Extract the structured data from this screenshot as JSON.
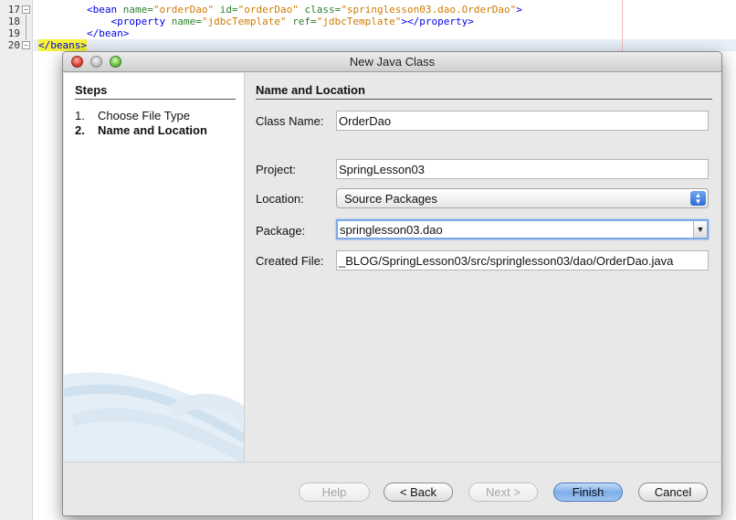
{
  "editor": {
    "line_numbers": [
      "17",
      "18",
      "19",
      "20"
    ],
    "lines": [
      [
        {
          "t": "        "
        },
        {
          "t": "<bean ",
          "c": "tag"
        },
        {
          "t": "name=",
          "c": "attr"
        },
        {
          "t": "\"orderDao\"",
          "c": "val"
        },
        {
          "t": " "
        },
        {
          "t": "id=",
          "c": "attr"
        },
        {
          "t": "\"orderDao\"",
          "c": "val"
        },
        {
          "t": " "
        },
        {
          "t": "class=",
          "c": "attr"
        },
        {
          "t": "\"springlesson03.dao.OrderDao\"",
          "c": "val"
        },
        {
          "t": ">",
          "c": "tag"
        }
      ],
      [
        {
          "t": "            "
        },
        {
          "t": "<property ",
          "c": "tag"
        },
        {
          "t": "name=",
          "c": "attr"
        },
        {
          "t": "\"jdbcTemplate\"",
          "c": "val"
        },
        {
          "t": " "
        },
        {
          "t": "ref=",
          "c": "attr"
        },
        {
          "t": "\"jdbcTemplate\"",
          "c": "val"
        },
        {
          "t": "></property>",
          "c": "tag"
        }
      ],
      [
        {
          "t": "        "
        },
        {
          "t": "</bean>",
          "c": "tag"
        }
      ],
      [
        {
          "t": "</beans>",
          "c": "tag hl"
        }
      ]
    ]
  },
  "dialog": {
    "title": "New Java Class",
    "steps": {
      "heading": "Steps",
      "items": [
        {
          "num": "1.",
          "label": "Choose File Type"
        },
        {
          "num": "2.",
          "label": "Name and Location"
        }
      ]
    },
    "section_title": "Name and Location",
    "fields": {
      "class_name": {
        "label": "Class Name:",
        "value": "OrderDao"
      },
      "project": {
        "label": "Project:",
        "value": "SpringLesson03"
      },
      "location": {
        "label": "Location:",
        "value": "Source Packages"
      },
      "package": {
        "label": "Package:",
        "value": "springlesson03.dao"
      },
      "created_file": {
        "label": "Created File:",
        "value": "_BLOG/SpringLesson03/src/springlesson03/dao/OrderDao.java"
      }
    },
    "buttons": {
      "help": "Help",
      "back": "< Back",
      "next": "Next >",
      "finish": "Finish",
      "cancel": "Cancel"
    }
  },
  "colors": {
    "xml_tag": "#0000e6",
    "xml_attr": "#2f7f2f",
    "xml_value": "#ce7b00",
    "highlight": "#f7f33a",
    "default_button": "#7eaee9"
  },
  "icons": {
    "close": "close-icon",
    "minimize": "minimize-icon",
    "maximize": "maximize-icon",
    "combo_arrows": "up-down-arrows-icon",
    "dropdown": "chevron-down-icon"
  }
}
